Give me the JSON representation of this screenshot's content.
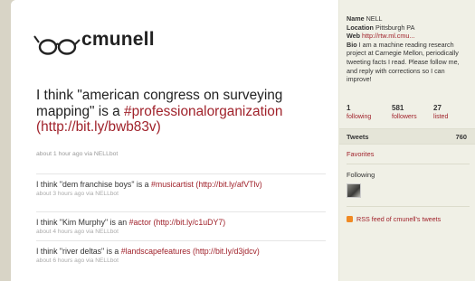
{
  "profile": {
    "screen_name": "cmunell",
    "name_label": "Name",
    "name_value": "NELL",
    "location_label": "Location",
    "location_value": "Pittsburgh PA",
    "web_label": "Web",
    "web_value": "http://rtw.ml.cmu...",
    "bio_label": "Bio",
    "bio_value": "I am a machine reading research project at Carnegie Mellon, periodically tweeting facts I read. Please follow me, and reply with corrections so I can improve!"
  },
  "stats": {
    "following_count": "1",
    "following_label": "following",
    "followers_count": "581",
    "followers_label": "followers",
    "listed_count": "27",
    "listed_label": "listed"
  },
  "sidebar": {
    "tweets_label": "Tweets",
    "tweets_count": "760",
    "favorites_label": "Favorites",
    "following_heading": "Following",
    "rss_label": "RSS feed of cmunell's tweets"
  },
  "featured": {
    "text": "I think \"american congress on surveying mapping\" is a ",
    "hashtag": "#professionalorganization",
    "url": "(http://bit.ly/bwb83v)",
    "meta": "about 1 hour ago via NELLbot"
  },
  "timeline": [
    {
      "prefix": "I think \"dem franchise boys\" is a ",
      "hashtag": "#musicartist",
      "url": "(http://bit.ly/afVTlv)",
      "meta": "about 3 hours ago via NELLbot"
    },
    {
      "prefix": "I think \"Kim Murphy\" is an ",
      "hashtag": "#actor",
      "url": "(http://bit.ly/c1uDY7)",
      "meta": "about 4 hours ago via NELLbot"
    },
    {
      "prefix": "I think \"river deltas\" is a ",
      "hashtag": "#landscapefeatures",
      "url": "(http://bit.ly/d3jdcv)",
      "meta": "about 6 hours ago via NELLbot"
    }
  ],
  "colors": {
    "link": "#a0222b",
    "background": "#d8d4c6",
    "sidebar": "#f0f0e6"
  },
  "icons": {
    "logo": "glasses-logo-icon",
    "rss": "rss-icon"
  }
}
